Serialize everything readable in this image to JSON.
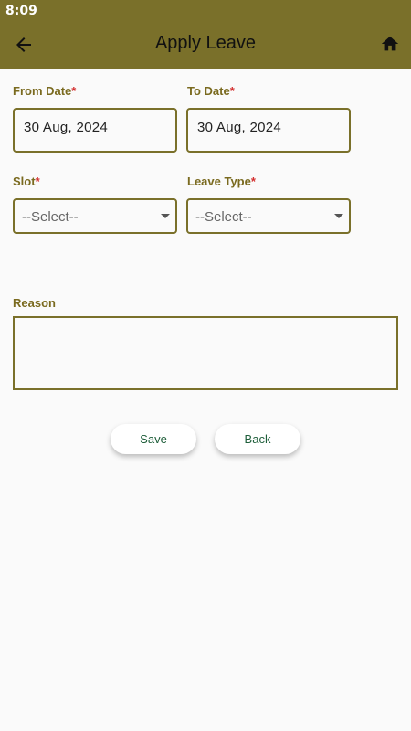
{
  "status_bar": {
    "time": "8:09"
  },
  "app_bar": {
    "title": "Apply Leave",
    "back_icon": "arrow-left-icon",
    "home_icon": "home-icon"
  },
  "form": {
    "from_date": {
      "label": "From Date",
      "required_mark": "*",
      "value": "30 Aug, 2024"
    },
    "to_date": {
      "label": "To Date",
      "required_mark": "*",
      "value": "30 Aug, 2024"
    },
    "slot": {
      "label": "Slot",
      "required_mark": "*",
      "value": "--Select--"
    },
    "leave_type": {
      "label": "Leave Type",
      "required_mark": "*",
      "value": "--Select--"
    },
    "reason": {
      "label": "Reason",
      "value": ""
    }
  },
  "buttons": {
    "save": "Save",
    "back": "Back"
  },
  "colors": {
    "primary": "#7a702a",
    "label": "#7a6a1f",
    "required": "#d32f2f",
    "button_text": "#1e5e3a",
    "background": "#fafafa"
  }
}
